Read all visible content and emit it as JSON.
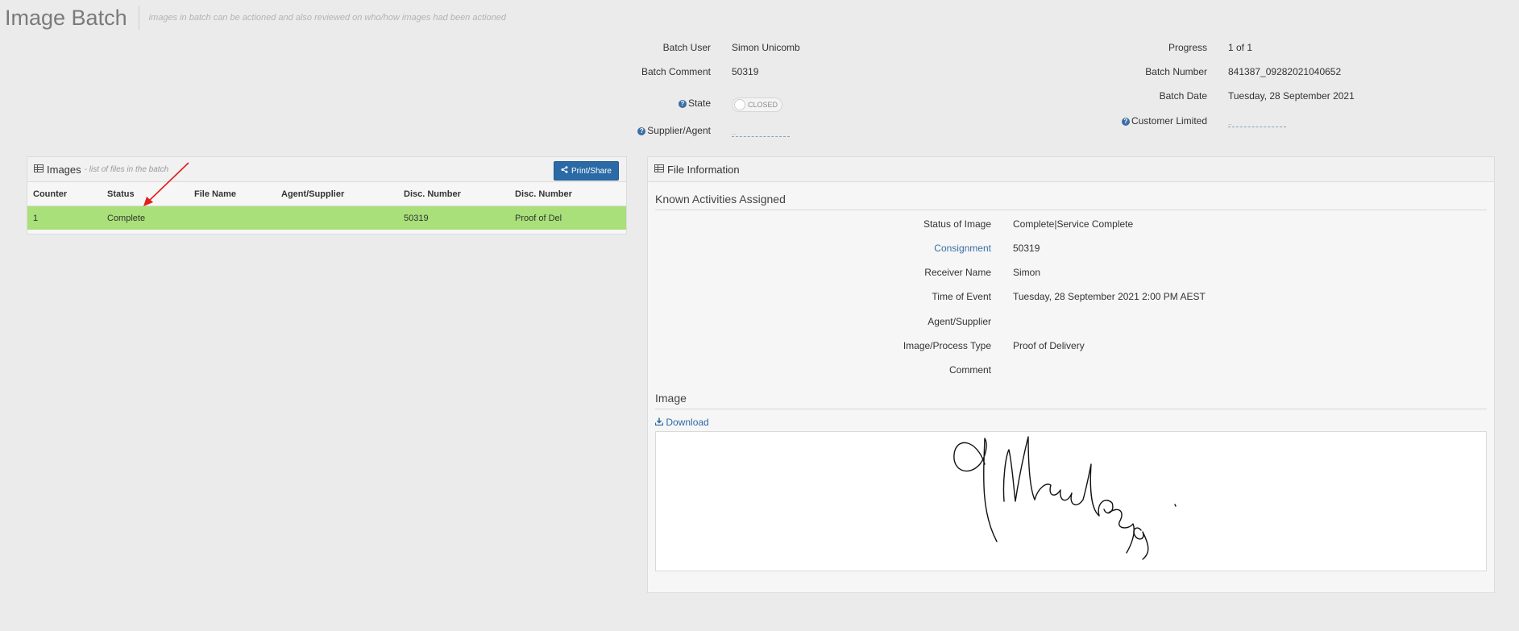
{
  "header": {
    "title": "Image Batch",
    "subtitle": "images in batch can be actioned and also reviewed on who/how images had been actioned"
  },
  "batch_info": {
    "batch_user_label": "Batch User",
    "batch_user_value": "Simon Unicomb",
    "batch_comment_label": "Batch Comment",
    "batch_comment_value": "50319",
    "state_label": "State",
    "state_value": "CLOSED",
    "supplier_label": "Supplier/Agent",
    "supplier_value": "..",
    "progress_label": "Progress",
    "progress_value": "1 of 1",
    "batch_number_label": "Batch Number",
    "batch_number_value": "841387_09282021040652",
    "batch_date_label": "Batch Date",
    "batch_date_value": "Tuesday, 28 September 2021",
    "customer_label": "Customer Limited",
    "customer_value": ".."
  },
  "images_panel": {
    "title": "Images",
    "subtitle": "- list of files in the batch",
    "print_button": "Print/Share",
    "columns": [
      "Counter",
      "Status",
      "File Name",
      "Agent/Supplier",
      "Disc. Number",
      "Disc. Number"
    ],
    "rows": [
      {
        "counter": "1",
        "status": "Complete",
        "file_name": "",
        "agent": "",
        "disc_number": "50319",
        "disc_type": "Proof of Del"
      }
    ]
  },
  "file_info": {
    "title": "File Information",
    "activities_title": "Known Activities Assigned",
    "fields": [
      {
        "label": "Status of Image",
        "value": "Complete|Service Complete"
      },
      {
        "label": "Consignment",
        "value": "50319"
      },
      {
        "label": "Receiver Name",
        "value": "Simon"
      },
      {
        "label": "Time of Event",
        "value": "Tuesday, 28 September 2021 2:00 PM AEST"
      },
      {
        "label": "Agent/Supplier",
        "value": ""
      },
      {
        "label": "Image/Process Type",
        "value": "Proof of Delivery"
      },
      {
        "label": "Comment",
        "value": ""
      }
    ],
    "image_title": "Image",
    "download_label": "Download"
  },
  "colors": {
    "accent": "#2a6aa6",
    "row_highlight": "#a9e07a",
    "background": "#ebebeb",
    "arrow": "#e0201b"
  }
}
